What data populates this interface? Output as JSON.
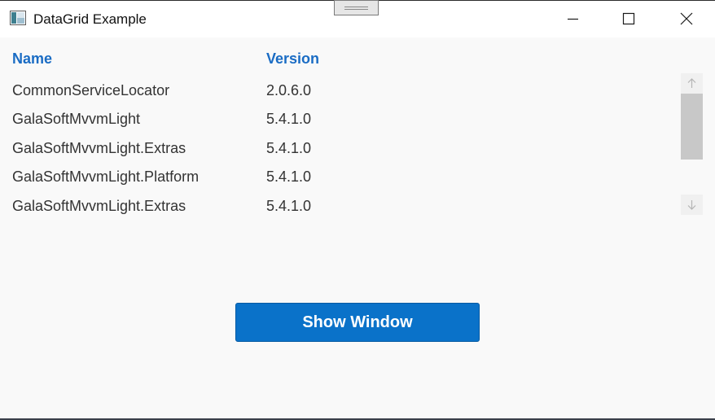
{
  "window": {
    "title": "DataGrid Example"
  },
  "grid": {
    "columns": [
      "Name",
      "Version"
    ],
    "rows": [
      {
        "name": "CommonServiceLocator",
        "version": "2.0.6.0"
      },
      {
        "name": "GalaSoftMvvmLight",
        "version": "5.4.1.0"
      },
      {
        "name": "GalaSoftMvvmLight.Extras",
        "version": "5.4.1.0"
      },
      {
        "name": "GalaSoftMvvmLight.Platform",
        "version": "5.4.1.0"
      },
      {
        "name": "GalaSoftMvvmLight.Extras",
        "version": "5.4.1.0"
      }
    ]
  },
  "actions": {
    "show_window_label": "Show Window"
  },
  "colors": {
    "accent": "#0a72c9",
    "header_text": "#1a6cc4",
    "background": "#f9f9f9"
  },
  "icons": {
    "app": "app-window-icon",
    "minimize": "minimize-icon",
    "maximize": "maximize-icon",
    "close": "close-icon",
    "scroll_up": "arrow-up-icon",
    "scroll_down": "arrow-down-icon"
  }
}
